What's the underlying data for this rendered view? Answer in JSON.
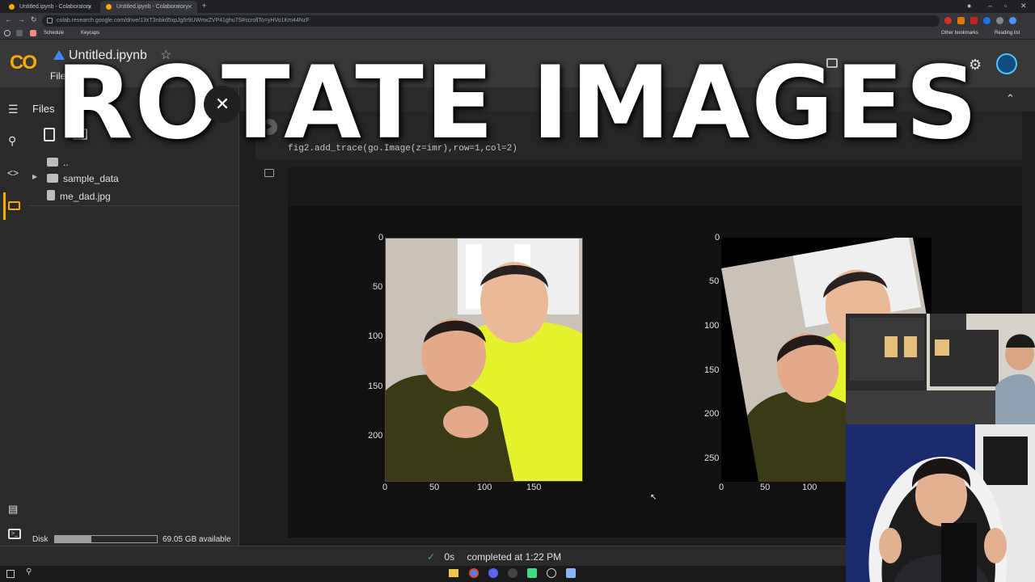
{
  "browser": {
    "tabs": [
      {
        "label": "Untitled.ipynb - Colaboratory"
      },
      {
        "label": "Untitled.ipynb - Colaboratory"
      }
    ],
    "url": "colab.research.google.com/drive/13xT3nbkd5xpJg6r9UWmxZVP41ghu7S#scrollTo=yHVo1Km44NzF",
    "bookmarks": {
      "schedule": "Schedule",
      "keycaps": "Keycaps",
      "other": "Other bookmarks",
      "reading": "Reading list"
    }
  },
  "colab": {
    "logo": "CO",
    "notebook_title": "Untitled.ipynb",
    "menu": {
      "file": "File",
      "edit": "Edit"
    },
    "files_title": "Files",
    "files": {
      "parent": "..",
      "folder": "sample_data",
      "file": "me_dad.jpg"
    },
    "disk_label": "Disk",
    "disk_available": "69.05 GB available",
    "code_line": "fig2.add_trace(go.Image(z=imr),row=1,col=2)",
    "status_time": "0s",
    "status_text": "completed at 1:22 PM"
  },
  "chart_data": [
    {
      "type": "image",
      "x_ticks": [
        "0",
        "50",
        "100",
        "150"
      ],
      "y_ticks": [
        "0",
        "50",
        "100",
        "150",
        "200"
      ]
    },
    {
      "type": "image",
      "x_ticks": [
        "0",
        "50",
        "100"
      ],
      "y_ticks": [
        "0",
        "50",
        "100",
        "150",
        "200",
        "250"
      ]
    }
  ],
  "overlay": {
    "title": "ROTATE IMAGES"
  },
  "colors": {
    "accent": "#f9ab00",
    "yellow_shirt": "#e6f22e",
    "background": "#1e1e1e",
    "success": "#4caf50"
  }
}
